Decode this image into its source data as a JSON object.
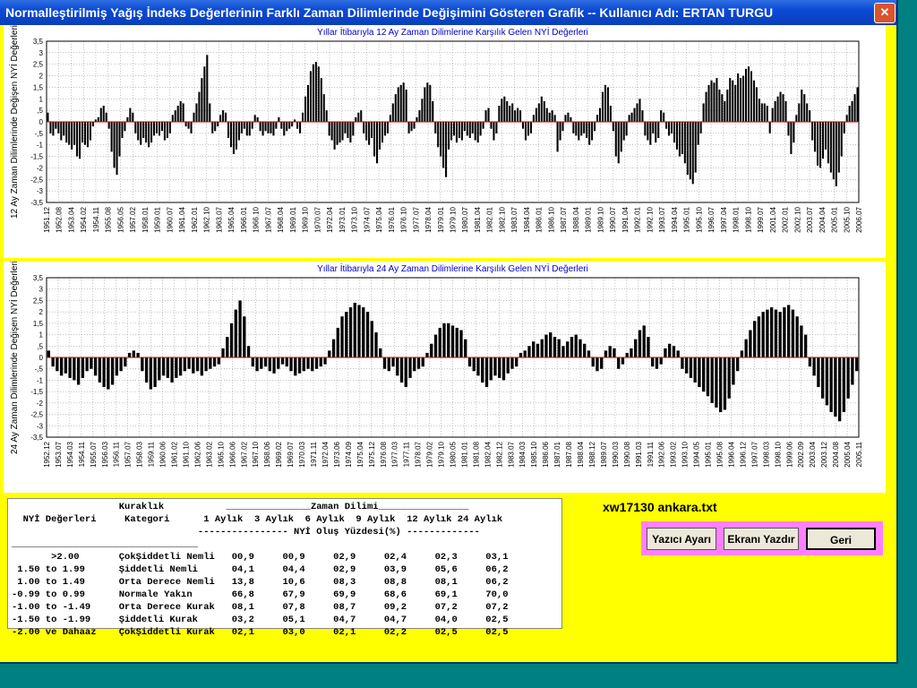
{
  "window": {
    "title": "Normalleştirilmiş Yağış İndeks Değerlerinin Farklı Zaman Dilimlerinde Değişimini Gösteren Grafik -- Kullanıcı Adı: ERTAN TURGU",
    "close_glyph": "✕"
  },
  "colors": {
    "bars": "#000000",
    "zero_line": "#cc0000",
    "grid": "#888888",
    "title": "#0000cc",
    "panel": "#ffff00"
  },
  "chart_data": [
    {
      "type": "bar",
      "title": "Yıllar İtibarıyla 12 Ay Zaman Dilimlerine Karşılık Gelen NYİ Değerleri",
      "ylabel": "12 Ay Zaman Dilimlerinde Değişen NYİ Değerleri",
      "ylim": [
        -3.5,
        3.5
      ],
      "y_ticks": [
        "3,5",
        "3",
        "2,5",
        "2",
        "1,5",
        "1",
        ",5",
        "0",
        "-,5",
        "-1",
        "-1,5",
        "-2",
        "-2,5",
        "-3",
        "-3,5"
      ],
      "x_ticks": [
        "1951.12",
        "1952.08",
        "1953.04",
        "1954.02",
        "1954.11",
        "1955.08",
        "1956.05",
        "1957.02",
        "1958.01",
        "1959.01",
        "1960.07",
        "1961.04",
        "1962.01",
        "1962.10",
        "1963.07",
        "1965.04",
        "1966.01",
        "1966.10",
        "1967.07",
        "1968.04",
        "1969.01",
        "1969.10",
        "1970.07",
        "1972.04",
        "1973.01",
        "1973.10",
        "1974.07",
        "1975.04",
        "1976.01",
        "1976.10",
        "1977.07",
        "1978.04",
        "1979.01",
        "1979.10",
        "1980.07",
        "1981.04",
        "1982.01",
        "1982.10",
        "1983.07",
        "1984.04",
        "1986.01",
        "1986.10",
        "1987.07",
        "1988.04",
        "1989.01",
        "1989.10",
        "1990.07",
        "1991.04",
        "1992.01",
        "1992.10",
        "1993.07",
        "1994.04",
        "1995.01",
        "1995.10",
        "1996.07",
        "1997.04",
        "1998.01",
        "1998.10",
        "1999.07",
        "2001.04",
        "2002.01",
        "2002.10",
        "2003.07",
        "2004.04",
        "2005.01",
        "2005.10",
        "2006.07"
      ],
      "x_range": [
        "1951.12",
        "2006.01"
      ],
      "grid": true,
      "values": [
        0.4,
        -0.5,
        -0.6,
        -0.3,
        -0.5,
        -0.8,
        -0.6,
        -0.9,
        -1.0,
        -1.2,
        -1.0,
        -1.5,
        -1.6,
        -0.9,
        -1.0,
        -1.1,
        -0.8,
        -0.2,
        0.1,
        0.2,
        0.6,
        0.7,
        0.4,
        -0.3,
        -1.3,
        -2.0,
        -2.3,
        -1.5,
        -0.7,
        -0.4,
        0.2,
        0.6,
        0.4,
        -0.5,
        -0.8,
        -1.0,
        -0.7,
        -0.9,
        -1.1,
        -0.9,
        -0.6,
        -0.5,
        -0.6,
        -0.4,
        -0.8,
        -0.7,
        -0.5,
        0.3,
        0.5,
        0.7,
        0.9,
        0.8,
        -0.2,
        -0.3,
        -0.5,
        0.4,
        0.8,
        1.3,
        1.9,
        2.4,
        2.9,
        0.8,
        -0.5,
        -0.4,
        -0.2,
        0.3,
        0.5,
        0.4,
        -0.7,
        -1.1,
        -1.4,
        -1.2,
        -0.8,
        -0.5,
        -0.3,
        -0.6,
        -0.6,
        -0.3,
        0.3,
        0.2,
        -0.4,
        -0.6,
        -0.4,
        -0.5,
        -0.5,
        -0.6,
        -0.3,
        0.2,
        -0.3,
        -0.6,
        -0.4,
        -0.3,
        -0.2,
        0.1,
        -0.3,
        -0.5,
        0.4,
        1.1,
        1.6,
        2.2,
        2.5,
        2.6,
        2.4,
        1.9,
        1.2,
        0.5,
        -0.6,
        -0.8,
        -1.2,
        -1.0,
        -0.9,
        -0.8,
        -0.5,
        -0.7,
        -0.9,
        -0.6,
        0.2,
        0.4,
        0.5,
        -0.5,
        -0.8,
        -1.0,
        -0.7,
        -1.5,
        -1.8,
        -1.2,
        -0.9,
        -0.6,
        -0.5,
        0.3,
        0.8,
        1.2,
        1.5,
        1.6,
        1.7,
        1.4,
        -0.5,
        -0.4,
        -0.3,
        0.2,
        0.5,
        1.0,
        1.5,
        1.7,
        1.6,
        0.9,
        -0.5,
        -1.1,
        -1.5,
        -2.0,
        -2.4,
        -1.2,
        -0.8,
        -0.6,
        -0.9,
        -0.7,
        -0.8,
        -0.4,
        -0.6,
        -0.7,
        -0.5,
        -0.8,
        -0.9,
        -0.6,
        -0.3,
        0.5,
        0.6,
        -0.3,
        -0.8,
        -0.5,
        0.7,
        1.0,
        1.1,
        0.9,
        0.7,
        0.8,
        0.5,
        0.6,
        0.5,
        -0.3,
        -0.8,
        -0.6,
        -0.5,
        0.3,
        0.6,
        0.8,
        1.1,
        0.9,
        0.6,
        0.4,
        0.5,
        0.3,
        -1.3,
        -0.8,
        -0.4,
        0.3,
        0.4,
        0.2,
        -0.5,
        -0.6,
        -0.8,
        -0.6,
        -0.5,
        -0.7,
        -1.0,
        -0.8,
        -0.4,
        0.3,
        0.6,
        1.3,
        1.6,
        1.5,
        0.7,
        -0.4,
        -1.5,
        -1.8,
        -1.3,
        -0.8,
        -0.6,
        0.3,
        0.4,
        0.6,
        0.8,
        1.0,
        0.5,
        -0.6,
        -0.8,
        -1.0,
        -0.5,
        -0.9,
        -0.7,
        0.5,
        0.4,
        -0.3,
        -0.6,
        -0.5,
        -0.9,
        -1.2,
        -1.5,
        -1.4,
        -1.8,
        -2.3,
        -2.5,
        -2.7,
        -2.2,
        -1.0,
        -0.5,
        0.8,
        1.3,
        1.6,
        1.8,
        1.7,
        1.9,
        1.4,
        1.2,
        0.9,
        1.4,
        1.9,
        1.8,
        1.6,
        2.1,
        1.9,
        2.0,
        2.3,
        2.4,
        2.2,
        1.8,
        1.5,
        1.0,
        0.8,
        0.8,
        0.7,
        -0.5,
        0.6,
        0.9,
        1.1,
        1.3,
        1.2,
        0.9,
        -0.6,
        -1.4,
        -0.9,
        0.3,
        0.8,
        1.4,
        1.2,
        0.8,
        0.5,
        -0.8,
        -1.3,
        -1.9,
        -2.0,
        -1.6,
        -1.2,
        -1.8,
        -2.2,
        -2.5,
        -2.8,
        -2.2,
        -1.5,
        -0.5,
        0.3,
        0.7,
        0.9,
        1.2,
        1.5
      ]
    },
    {
      "type": "bar",
      "title": "Yıllar İtibarıyla 24 Ay Zaman Dilimlerine Karşılık Gelen NYİ Değerleri",
      "ylabel": "24 Ay Zaman Dilimlerinde Değişen NYİ Değerleri",
      "ylim": [
        -3.5,
        3.5
      ],
      "y_ticks": [
        "3,5",
        "3",
        "2,5",
        "2",
        "1,5",
        "1",
        ",5",
        "0",
        "-,5",
        "-1",
        "-1,5",
        "-2",
        "-2,5",
        "-3",
        "-3,5"
      ],
      "x_ticks": [
        "1952.12",
        "1953.07",
        "1954.03",
        "1954.11",
        "1955.07",
        "1956.03",
        "1956.11",
        "1957.07",
        "1958.03",
        "1959.11",
        "1960.06",
        "1961.02",
        "1961.10",
        "1962.06",
        "1963.02",
        "1965.10",
        "1966.06",
        "1967.02",
        "1967.10",
        "1968.06",
        "1969.02",
        "1969.07",
        "1970.03",
        "1971.11",
        "1972.04",
        "1973.06",
        "1974.09",
        "1975.04",
        "1975.12",
        "1976.08",
        "1977.03",
        "1977.11",
        "1978.07",
        "1979.02",
        "1979.10",
        "1980.05",
        "1981.01",
        "1981.08",
        "1982.04",
        "1982.12",
        "1983.07",
        "1984.03",
        "1985.10",
        "1986.06",
        "1987.01",
        "1987.08",
        "1988.04",
        "1988.12",
        "1989.07",
        "1990.03",
        "1990.08",
        "1991.03",
        "1991.11",
        "1992.06",
        "1993.02",
        "1993.10",
        "1994.05",
        "1995.01",
        "1995.08",
        "1996.04",
        "1996.12",
        "1997.07",
        "1998.03",
        "1998.10",
        "1999.06",
        "2002.09",
        "2003.04",
        "2003.12",
        "2004.08",
        "2005.04",
        "2005.11"
      ],
      "x_range": [
        "1952.12",
        "2006.01"
      ],
      "grid": true,
      "values": [
        0.3,
        -0.4,
        -0.6,
        -0.8,
        -0.7,
        -0.9,
        -1.0,
        -1.2,
        -0.9,
        -0.6,
        -0.5,
        -0.8,
        -1.1,
        -1.3,
        -1.4,
        -1.2,
        -0.8,
        -0.6,
        -0.4,
        0.2,
        0.3,
        0.2,
        -0.6,
        -1.1,
        -1.4,
        -1.3,
        -1.0,
        -0.8,
        -0.9,
        -1.1,
        -0.9,
        -0.8,
        -0.6,
        -0.5,
        -0.7,
        -0.6,
        -0.8,
        -0.6,
        -0.5,
        -0.4,
        -0.3,
        0.4,
        0.9,
        1.5,
        2.1,
        2.5,
        1.8,
        0.5,
        -0.4,
        -0.6,
        -0.5,
        -0.4,
        -0.6,
        -0.7,
        -0.5,
        -0.3,
        -0.4,
        -0.6,
        -0.8,
        -0.7,
        -0.6,
        -0.5,
        -0.6,
        -0.5,
        -0.4,
        -0.3,
        0.3,
        0.8,
        1.3,
        1.8,
        2.0,
        2.2,
        2.4,
        2.3,
        2.2,
        2.0,
        1.6,
        1.1,
        0.4,
        -0.5,
        -0.6,
        -0.4,
        -0.8,
        -1.1,
        -1.3,
        -0.9,
        -0.6,
        -0.5,
        -0.4,
        0.2,
        0.6,
        1.0,
        1.3,
        1.5,
        1.5,
        1.4,
        1.3,
        1.2,
        0.8,
        -0.4,
        -0.6,
        -0.8,
        -1.1,
        -1.3,
        -1.0,
        -0.8,
        -0.9,
        -1.0,
        -0.7,
        -0.5,
        -0.4,
        0.2,
        0.3,
        0.5,
        0.7,
        0.6,
        0.8,
        1.0,
        1.1,
        0.9,
        0.8,
        0.5,
        0.7,
        0.9,
        1.0,
        0.8,
        0.6,
        0.3,
        -0.4,
        -0.6,
        -0.5,
        0.3,
        0.5,
        0.4,
        -0.5,
        -0.3,
        0.2,
        0.4,
        0.8,
        1.2,
        1.4,
        0.9,
        -0.4,
        -0.5,
        -0.3,
        0.4,
        0.6,
        0.5,
        0.3,
        -0.5,
        -0.7,
        -0.9,
        -1.1,
        -1.3,
        -1.5,
        -1.7,
        -2.0,
        -2.2,
        -2.4,
        -2.3,
        -1.8,
        -1.2,
        -0.6,
        0.3,
        0.8,
        1.2,
        1.6,
        1.8,
        2.0,
        2.1,
        2.2,
        2.1,
        2.0,
        2.2,
        2.3,
        2.1,
        1.8,
        1.4,
        1.0,
        -0.4,
        -0.8,
        -1.3,
        -1.8,
        -2.1,
        -2.4,
        -2.6,
        -2.8,
        -2.4,
        -1.8,
        -1.2,
        -0.6
      ]
    }
  ],
  "table": {
    "lines": [
      "                   Kuraklık           _______________Zaman Dilimi________________",
      "  NYİ Değerleri     Kategori      1 Aylık  3 Aylık  6 Aylık  9 Aylık  12 Aylık 24 Aylık",
      "                                 ---------------- NYİ Oluş Yüzdesi(%) -------------",
      "_________________________________",
      "       >2.00       ÇokŞiddetli Nemli   00,9     00,9     02,9     02,4     02,3     03,1",
      " 1.50 to 1.99      Şiddetli Nemli      04,1     04,4     02,9     03,9     05,6     06,2",
      " 1.00 to 1.49      Orta Derece Nemli   13,8     10,6     08,3     08,8     08,1     06,2",
      "-0.99 to 0.99      Normale Yakın       66,8     67,9     69,9     68,6     69,1     70,0",
      "-1.00 to -1.49     Orta Derece Kurak   08,1     07,8     08,7     09,2     07,2     07,2",
      "-1.50 to -1.99     Şiddetli Kurak      03,2     05,1     04,7     04,7     04,0     02,5",
      "-2.00 ve Dahaaz    ÇokŞiddetli Kurak   02,1     03,0     02,1     02,2     02,5     02,5"
    ]
  },
  "filename": "xw17130 ankara.txt",
  "buttons": {
    "print_setup": "Yazıcı Ayarı",
    "print": "Ekranı Yazdır",
    "back": "Geri"
  }
}
